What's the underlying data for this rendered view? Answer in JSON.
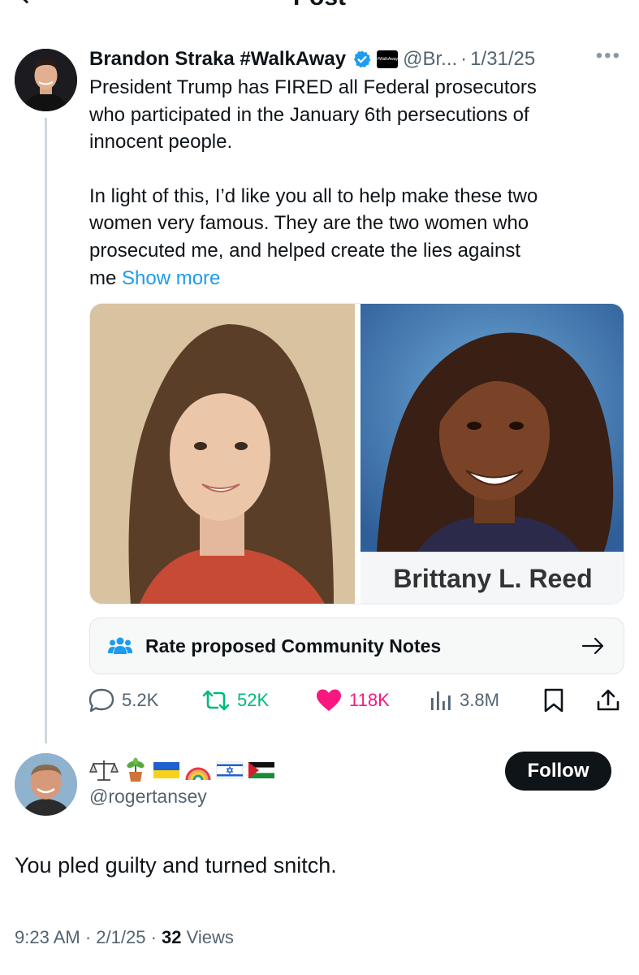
{
  "header": {
    "title": "Post"
  },
  "post": {
    "author_name": "Brandon Straka #WalkAway",
    "affiliate_badge_text": "#WalkAway",
    "handle": "@Br...",
    "separator": "·",
    "date": "1/31/25",
    "more_label": "•••",
    "paragraphs": [
      "President Trump has FIRED all Federal prosecutors\nwho participated in the January 6th persecutions of\ninnocent people.",
      "In light of this, I’d like you all to help make these two\nwomen very famous. They are the two women who\nprosecuted me, and helped create the lies against\nme "
    ],
    "show_more": "Show more",
    "media": {
      "right_caption": "Brittany L. Reed"
    },
    "community_notes": {
      "label": "Rate proposed Community Notes"
    },
    "stats": {
      "replies": "5.2K",
      "reposts": "52K",
      "likes": "118K",
      "views": "3.8M"
    },
    "colors": {
      "accent": "#1d9bf0",
      "repost": "#00ba7c",
      "like": "#f91880",
      "text": "#0f1419",
      "muted": "#536471"
    }
  },
  "reply": {
    "display_name_emojis": [
      "balance-scale",
      "potted-plant",
      "ukraine-flag",
      "rainbow",
      "israel-flag",
      "palestine-flag"
    ],
    "handle": "@rogertansey",
    "follow_label": "Follow",
    "text": "You pled guilty and turned snitch.",
    "time": "9:23 AM",
    "meta_sep": " · ",
    "date": "2/1/25",
    "views_count": "32",
    "views_label": " Views"
  }
}
